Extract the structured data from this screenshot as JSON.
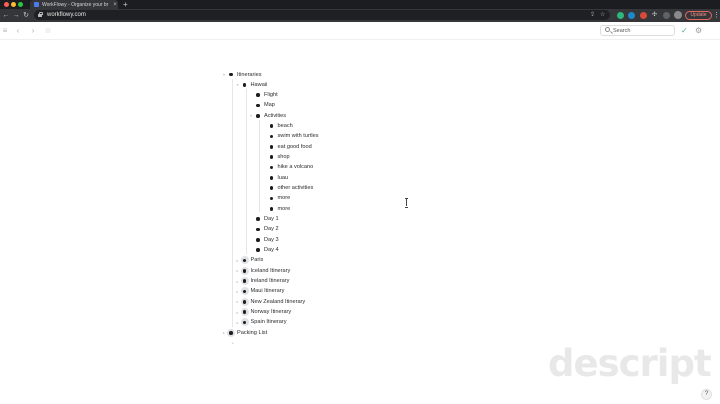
{
  "browser": {
    "tab_title": "WorkFlowy - Organize your br",
    "tab_close": "×",
    "new_tab": "+",
    "url": "workflowy.com",
    "update_label": "Update",
    "back_glyph": "←",
    "forward_glyph": "→",
    "reload_glyph": "↻",
    "share_glyph": "⇪",
    "star_glyph": "☆",
    "puzzle_glyph": "✣",
    "menu_glyph": "⋮",
    "colors": {
      "update_border": "#e3675c",
      "tab_bg": "#35363a",
      "chrome_bg": "#1c1d20"
    }
  },
  "appbar": {
    "menu_glyph": "≡",
    "back_glyph": "‹",
    "forward_glyph": "›",
    "star_glyph": "☆",
    "search_placeholder": "Search",
    "check_glyph": "✓",
    "gear_glyph": "⚙"
  },
  "outline": [
    {
      "label": "Itineraries",
      "depth": 0,
      "collapsed": false,
      "caret": "▾"
    },
    {
      "label": "Hawaii",
      "depth": 1,
      "collapsed": false,
      "caret": "▾"
    },
    {
      "label": "Flight",
      "depth": 2,
      "collapsed": false,
      "caret": ""
    },
    {
      "label": "Map",
      "depth": 2,
      "collapsed": false,
      "caret": ""
    },
    {
      "label": "Activities",
      "depth": 2,
      "collapsed": false,
      "caret": "▾"
    },
    {
      "label": "beach",
      "depth": 3,
      "collapsed": false,
      "caret": ""
    },
    {
      "label": "swim with turtles",
      "depth": 3,
      "collapsed": false,
      "caret": ""
    },
    {
      "label": "eat good food",
      "depth": 3,
      "collapsed": false,
      "caret": ""
    },
    {
      "label": "shop",
      "depth": 3,
      "collapsed": false,
      "caret": ""
    },
    {
      "label": "hike a volcano",
      "depth": 3,
      "collapsed": false,
      "caret": ""
    },
    {
      "label": "luau",
      "depth": 3,
      "collapsed": false,
      "caret": ""
    },
    {
      "label": "other activities",
      "depth": 3,
      "collapsed": false,
      "caret": ""
    },
    {
      "label": "more",
      "depth": 3,
      "collapsed": false,
      "caret": ""
    },
    {
      "label": "more",
      "depth": 3,
      "collapsed": false,
      "caret": ""
    },
    {
      "label": "Day 1",
      "depth": 2,
      "collapsed": false,
      "caret": ""
    },
    {
      "label": "Day 2",
      "depth": 2,
      "collapsed": false,
      "caret": ""
    },
    {
      "label": "Day 3",
      "depth": 2,
      "collapsed": false,
      "caret": ""
    },
    {
      "label": "Day 4",
      "depth": 2,
      "collapsed": false,
      "caret": ""
    },
    {
      "label": "Paris",
      "depth": 1,
      "collapsed": true,
      "caret": "▸"
    },
    {
      "label": "Iceland Itinerary",
      "depth": 1,
      "collapsed": true,
      "caret": "▸"
    },
    {
      "label": "Ireland Itinerary",
      "depth": 1,
      "collapsed": true,
      "caret": "▸"
    },
    {
      "label": "Maui Itinerary",
      "depth": 1,
      "collapsed": true,
      "caret": "▸"
    },
    {
      "label": "New Zealand Itinerary",
      "depth": 1,
      "collapsed": true,
      "caret": "▸"
    },
    {
      "label": "Norway Itinerary",
      "depth": 1,
      "collapsed": true,
      "caret": "▸"
    },
    {
      "label": "Spain Itinerary",
      "depth": 1,
      "collapsed": true,
      "caret": "▸"
    },
    {
      "label": "Packing List",
      "depth": 0,
      "collapsed": true,
      "caret": "▸"
    }
  ],
  "new_item_glyph": "•",
  "watermark": "descript",
  "help_glyph": "?"
}
